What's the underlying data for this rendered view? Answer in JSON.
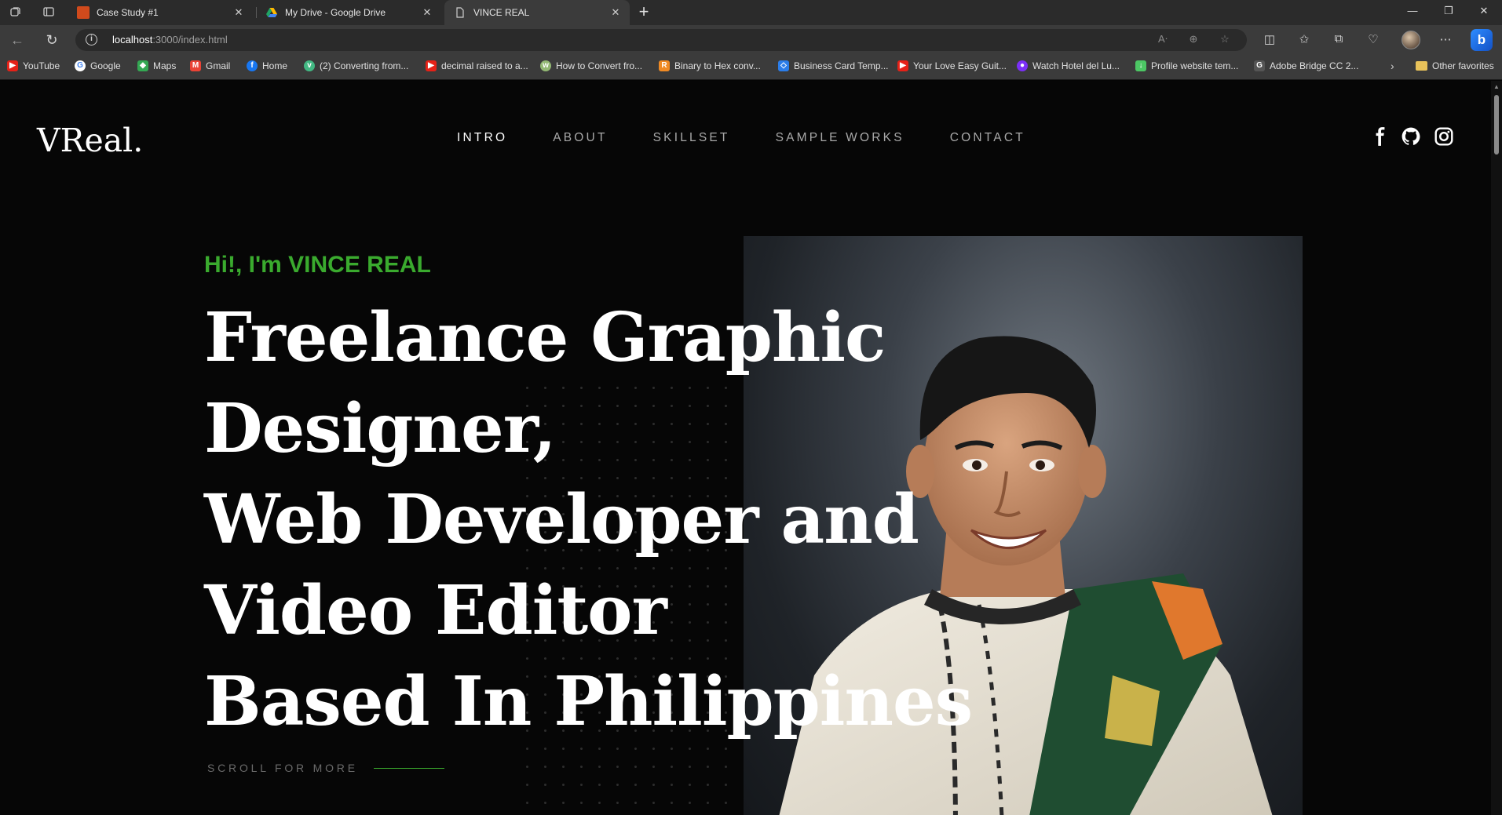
{
  "browser": {
    "tabs": [
      {
        "title": "Case Study #1",
        "favicon_color": "#d04a1c"
      },
      {
        "title": "My Drive - Google Drive",
        "favicon_color": "#1fa463"
      },
      {
        "title": "VINCE REAL",
        "favicon_color": "#cfcfcf"
      }
    ],
    "url_host": "localhost",
    "url_path": ":3000/index.html",
    "bookmarks": [
      {
        "label": "YouTube",
        "icon": "youtube-icon",
        "color": "#e62117"
      },
      {
        "label": "Google",
        "icon": "google-icon",
        "color": "#ffffff"
      },
      {
        "label": "Maps",
        "icon": "maps-icon",
        "color": "#34a853"
      },
      {
        "label": "Gmail",
        "icon": "gmail-icon",
        "color": "#ea4335"
      },
      {
        "label": "Home",
        "icon": "facebook-icon",
        "color": "#1877f2"
      },
      {
        "label": "(2) Converting from...",
        "icon": "vuejs-icon",
        "color": "#42b883"
      },
      {
        "label": "decimal raised to a...",
        "icon": "youtube-icon",
        "color": "#e62117"
      },
      {
        "label": "How to Convert fro...",
        "icon": "wikihow-icon",
        "color": "#93b874"
      },
      {
        "label": "Binary to Hex conv...",
        "icon": "rapidtables-icon",
        "color": "#f08a24"
      },
      {
        "label": "Business Card Temp...",
        "icon": "vistaprint-icon",
        "color": "#2b7de9"
      },
      {
        "label": "Your Love Easy Guit...",
        "icon": "youtube-icon",
        "color": "#e62117"
      },
      {
        "label": "Watch Hotel del Lu...",
        "icon": "stream-icon",
        "color": "#7b2ff7"
      },
      {
        "label": "Profile website tem...",
        "icon": "freepik-icon",
        "color": "#4cc764"
      },
      {
        "label": "Adobe Bridge CC 2...",
        "icon": "g-icon",
        "color": "#555555"
      }
    ],
    "other_favorites": "Other favorites"
  },
  "site": {
    "logo": "VReal.",
    "nav": [
      {
        "label": "INTRO",
        "active": true
      },
      {
        "label": "ABOUT",
        "active": false
      },
      {
        "label": "SKILLSET",
        "active": false
      },
      {
        "label": "SAMPLE WORKS",
        "active": false
      },
      {
        "label": "CONTACT",
        "active": false
      }
    ],
    "social_icons": [
      "facebook-icon",
      "github-icon",
      "instagram-icon"
    ],
    "hero": {
      "greeting": "Hi!, I'm VINCE REAL",
      "headline_lines": [
        "Freelance Graphic",
        "Designer,",
        "Web Developer and",
        "Video Editor",
        "Based In Philippines"
      ],
      "scroll_label": "SCROLL FOR MORE"
    },
    "colors": {
      "accent": "#3aaa2e",
      "background": "#060606",
      "text": "#ffffff",
      "nav_inactive": "#a9a9a9"
    }
  }
}
